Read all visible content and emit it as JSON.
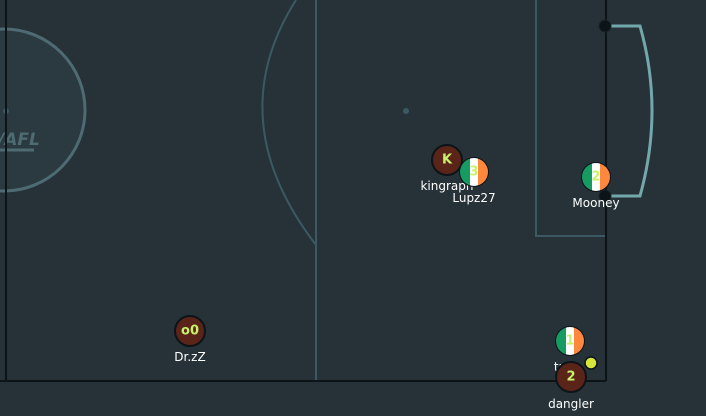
{
  "game": {
    "logo_text": "/AFL",
    "colors": {
      "field": "#263238",
      "lines": "#3c5963",
      "boundary": "#0c1418",
      "goal": "#73a8aa",
      "red_team": "#5b2419",
      "ball": "#d7e63a",
      "avatar_text": "#c6f36a"
    },
    "players": [
      {
        "id": "kingraph",
        "name": "kingraph",
        "avatar": "K",
        "team": "red"
      },
      {
        "id": "lupz27",
        "name": "Lupz27",
        "avatar": "3",
        "team": "blue"
      },
      {
        "id": "mooney",
        "name": "Mooney",
        "avatar": "2",
        "team": "blue"
      },
      {
        "id": "drzz",
        "name": "Dr.zZ",
        "avatar": "o0",
        "team": "red"
      },
      {
        "id": "treasure",
        "name": "tre...",
        "avatar": "1",
        "team": "blue"
      },
      {
        "id": "dangler",
        "name": "dangler",
        "avatar": "2",
        "team": "red"
      }
    ]
  }
}
